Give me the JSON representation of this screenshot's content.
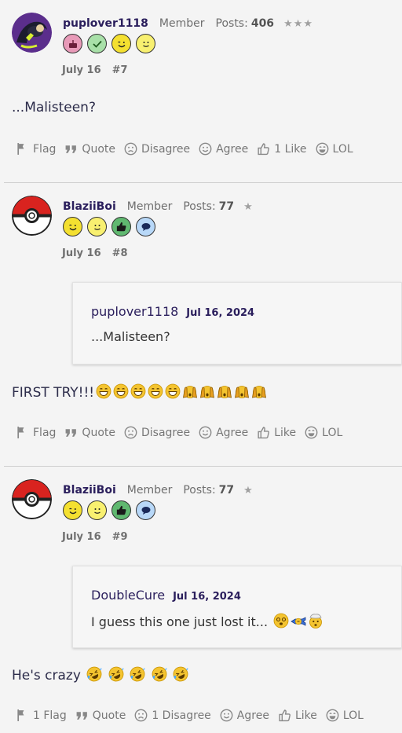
{
  "posts": [
    {
      "username": "puplover1118",
      "role": "Member",
      "posts_label": "Posts:",
      "posts_count": "406",
      "stars": "★★★",
      "date": "July 16",
      "number": "#7",
      "message": "...Malisteen?",
      "actions": {
        "flag": "Flag",
        "quote": "Quote",
        "disagree": "Disagree",
        "agree": "Agree",
        "like": "1 Like",
        "lol": "LOL"
      }
    },
    {
      "username": "BlaziiBoi",
      "role": "Member",
      "posts_label": "Posts:",
      "posts_count": "77",
      "stars": "★",
      "date": "July 16",
      "number": "#8",
      "quote": {
        "user": "puplover1118",
        "date": "Jul 16, 2024",
        "text": "...Malisteen?"
      },
      "message": "FIRST TRY!!!",
      "actions": {
        "flag": "Flag",
        "quote": "Quote",
        "disagree": "Disagree",
        "agree": "Agree",
        "like": "Like",
        "lol": "LOL"
      }
    },
    {
      "username": "BlaziiBoi",
      "role": "Member",
      "posts_label": "Posts:",
      "posts_count": "77",
      "stars": "★",
      "date": "July 16",
      "number": "#9",
      "quote": {
        "user": "DoubleCure",
        "date": "Jul 16, 2024",
        "text": "I guess this one just lost it..."
      },
      "message": "He's crazy",
      "actions": {
        "flag": "1 Flag",
        "quote": "Quote",
        "disagree": "1 Disagree",
        "agree": "Agree",
        "like": "Like",
        "lol": "LOL"
      }
    }
  ],
  "colors": {
    "username": "#2a1e5c",
    "muted": "#6e6e6e",
    "background": "#f4f4f4"
  }
}
